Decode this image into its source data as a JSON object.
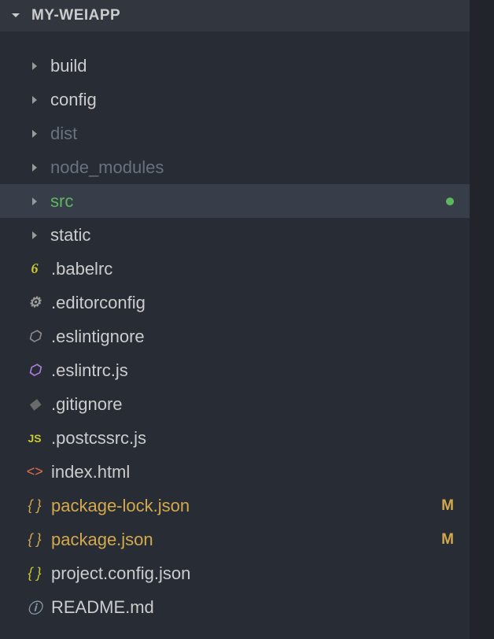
{
  "header": {
    "title": "MY-WEIAPP"
  },
  "items": [
    {
      "type": "folder",
      "label": "build",
      "labelClass": "",
      "selected": false
    },
    {
      "type": "folder",
      "label": "config",
      "labelClass": "",
      "selected": false
    },
    {
      "type": "folder",
      "label": "dist",
      "labelClass": "dimmed",
      "selected": false
    },
    {
      "type": "folder",
      "label": "node_modules",
      "labelClass": "dimmed",
      "selected": false
    },
    {
      "type": "folder",
      "label": "src",
      "labelClass": "green",
      "selected": true,
      "badge": "dot"
    },
    {
      "type": "folder",
      "label": "static",
      "labelClass": "",
      "selected": false
    },
    {
      "type": "file",
      "label": ".babelrc",
      "icon": "babel",
      "iconGlyph": "6"
    },
    {
      "type": "file",
      "label": ".editorconfig",
      "icon": "gear",
      "iconGlyph": "⚙"
    },
    {
      "type": "file",
      "label": ".eslintignore",
      "icon": "eslint-ignore",
      "iconGlyph": "⬡"
    },
    {
      "type": "file",
      "label": ".eslintrc.js",
      "icon": "eslint",
      "iconGlyph": "⬡"
    },
    {
      "type": "file",
      "label": ".gitignore",
      "icon": "git",
      "iconGlyph": "◆"
    },
    {
      "type": "file",
      "label": ".postcssrc.js",
      "icon": "js",
      "iconGlyph": "JS"
    },
    {
      "type": "file",
      "label": "index.html",
      "icon": "html",
      "iconGlyph": "<>"
    },
    {
      "type": "file",
      "label": "package-lock.json",
      "labelClass": "yellow",
      "icon": "json",
      "iconGlyph": "{ }",
      "badge": "M"
    },
    {
      "type": "file",
      "label": "package.json",
      "labelClass": "yellow",
      "icon": "json",
      "iconGlyph": "{ }",
      "badge": "M"
    },
    {
      "type": "file",
      "label": "project.config.json",
      "icon": "json2",
      "iconGlyph": "{ }"
    },
    {
      "type": "file",
      "label": "README.md",
      "icon": "info",
      "iconGlyph": "ⓘ"
    }
  ]
}
